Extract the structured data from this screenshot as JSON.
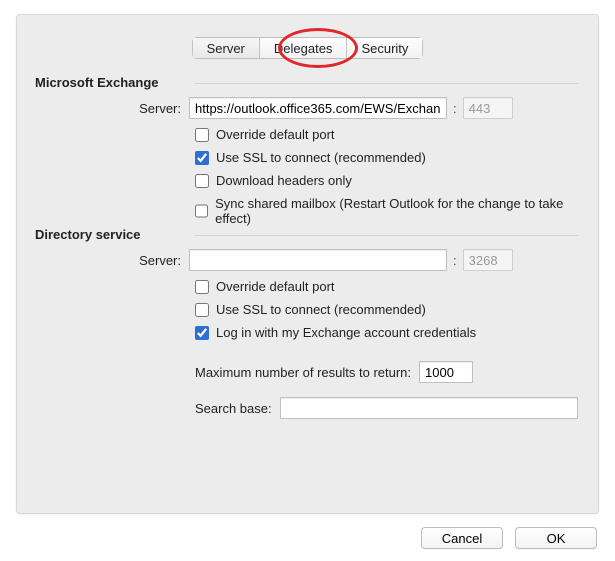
{
  "tabs": {
    "server": "Server",
    "delegates": "Delegates",
    "security": "Security",
    "selected": "server"
  },
  "section_exchange": {
    "title": "Microsoft Exchange",
    "server_label": "Server:",
    "server_value": "https://outlook.office365.com/EWS/Exchang",
    "port_sep": ":",
    "port_value": "443",
    "checks": {
      "override_port": "Override default port",
      "use_ssl": "Use SSL to connect (recommended)",
      "headers_only": "Download headers only",
      "sync_shared": "Sync shared mailbox (Restart Outlook for the change to take effect)"
    }
  },
  "section_directory": {
    "title": "Directory service",
    "server_label": "Server:",
    "server_value": "",
    "port_sep": ":",
    "port_value": "3268",
    "checks": {
      "override_port": "Override default port",
      "use_ssl": "Use SSL to connect (recommended)",
      "login_exchange": "Log in with my Exchange account credentials"
    },
    "max_results_label": "Maximum number of results to return:",
    "max_results_value": "1000",
    "search_base_label": "Search base:",
    "search_base_value": ""
  },
  "buttons": {
    "cancel": "Cancel",
    "ok": "OK"
  }
}
